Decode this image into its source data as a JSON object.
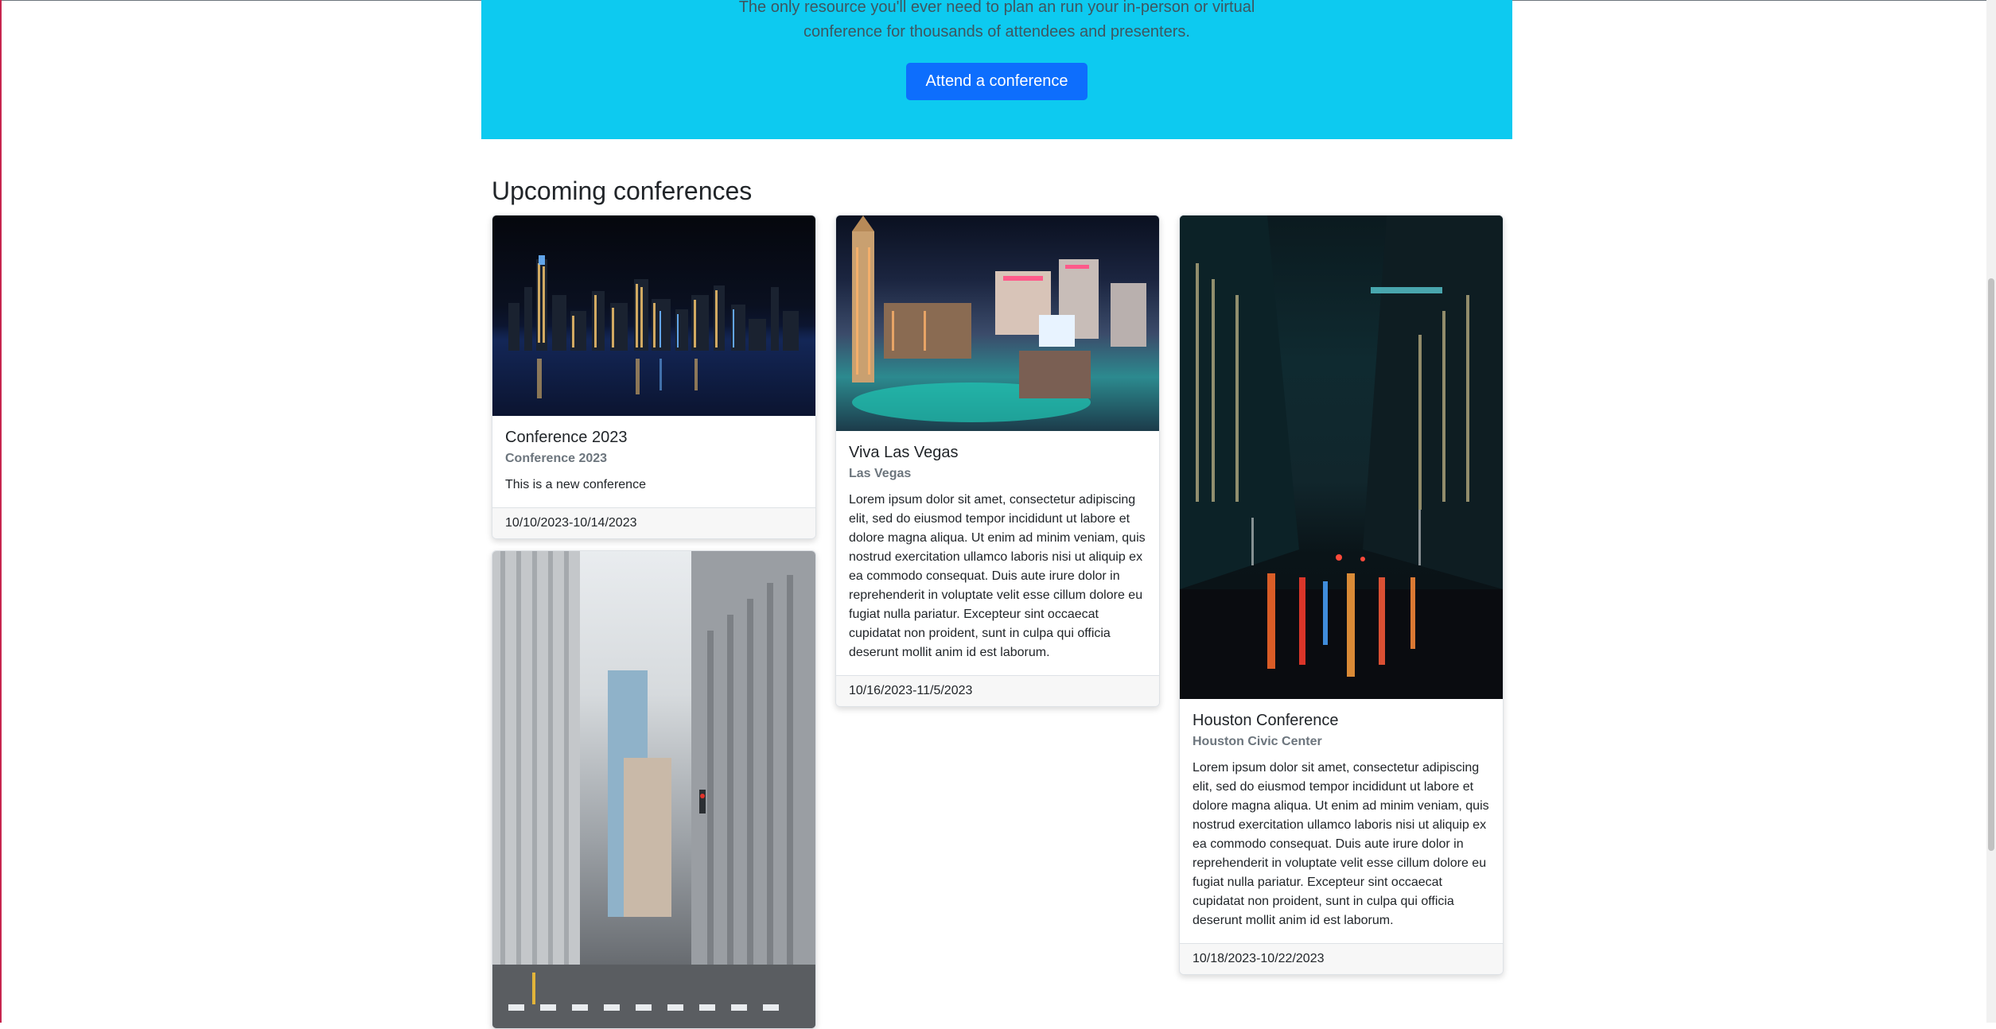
{
  "hero": {
    "lead": "The only resource you'll ever need to plan an run your in-person or virtual conference for thousands of attendees and presenters.",
    "button_label": "Attend a conference"
  },
  "section": {
    "title": "Upcoming conferences"
  },
  "conferences": [
    {
      "title": "Conference 2023",
      "subtitle": "Conference 2023",
      "text": "This is a new conference",
      "dates": "10/10/2023-10/14/2023",
      "image": "san-francisco-night-skyline"
    },
    {
      "title": "Viva Las Vegas",
      "subtitle": "Las Vegas",
      "text": "Lorem ipsum dolor sit amet, consectetur adipiscing elit, sed do eiusmod tempor incididunt ut labore et dolore magna aliqua. Ut enim ad minim veniam, quis nostrud exercitation ullamco laboris nisi ut aliquip ex ea commodo consequat. Duis aute irure dolor in reprehenderit in voluptate velit esse cillum dolore eu fugiat nulla pariatur. Excepteur sint occaecat cupidatat non proident, sunt in culpa qui officia deserunt mollit anim id est laborum.",
      "dates": "10/16/2023-11/5/2023",
      "image": "las-vegas-night-strip"
    },
    {
      "title": "Houston Conference",
      "subtitle": "Houston Civic Center",
      "text": "Lorem ipsum dolor sit amet, consectetur adipiscing elit, sed do eiusmod tempor incididunt ut labore et dolore magna aliqua. Ut enim ad minim veniam, quis nostrud exercitation ullamco laboris nisi ut aliquip ex ea commodo consequat. Duis aute irure dolor in reprehenderit in voluptate velit esse cillum dolore eu fugiat nulla pariatur. Excepteur sint occaecat cupidatat non proident, sunt in culpa qui officia deserunt mollit anim id est laborum.",
      "dates": "10/18/2023-10/22/2023",
      "image": "houston-street-night"
    },
    {
      "image": "new-york-street-day"
    }
  ],
  "colors": {
    "hero_bg": "#0dcaf0",
    "primary": "#0d6efd",
    "muted": "#6c757d",
    "footer_bg": "#f7f7f7"
  }
}
